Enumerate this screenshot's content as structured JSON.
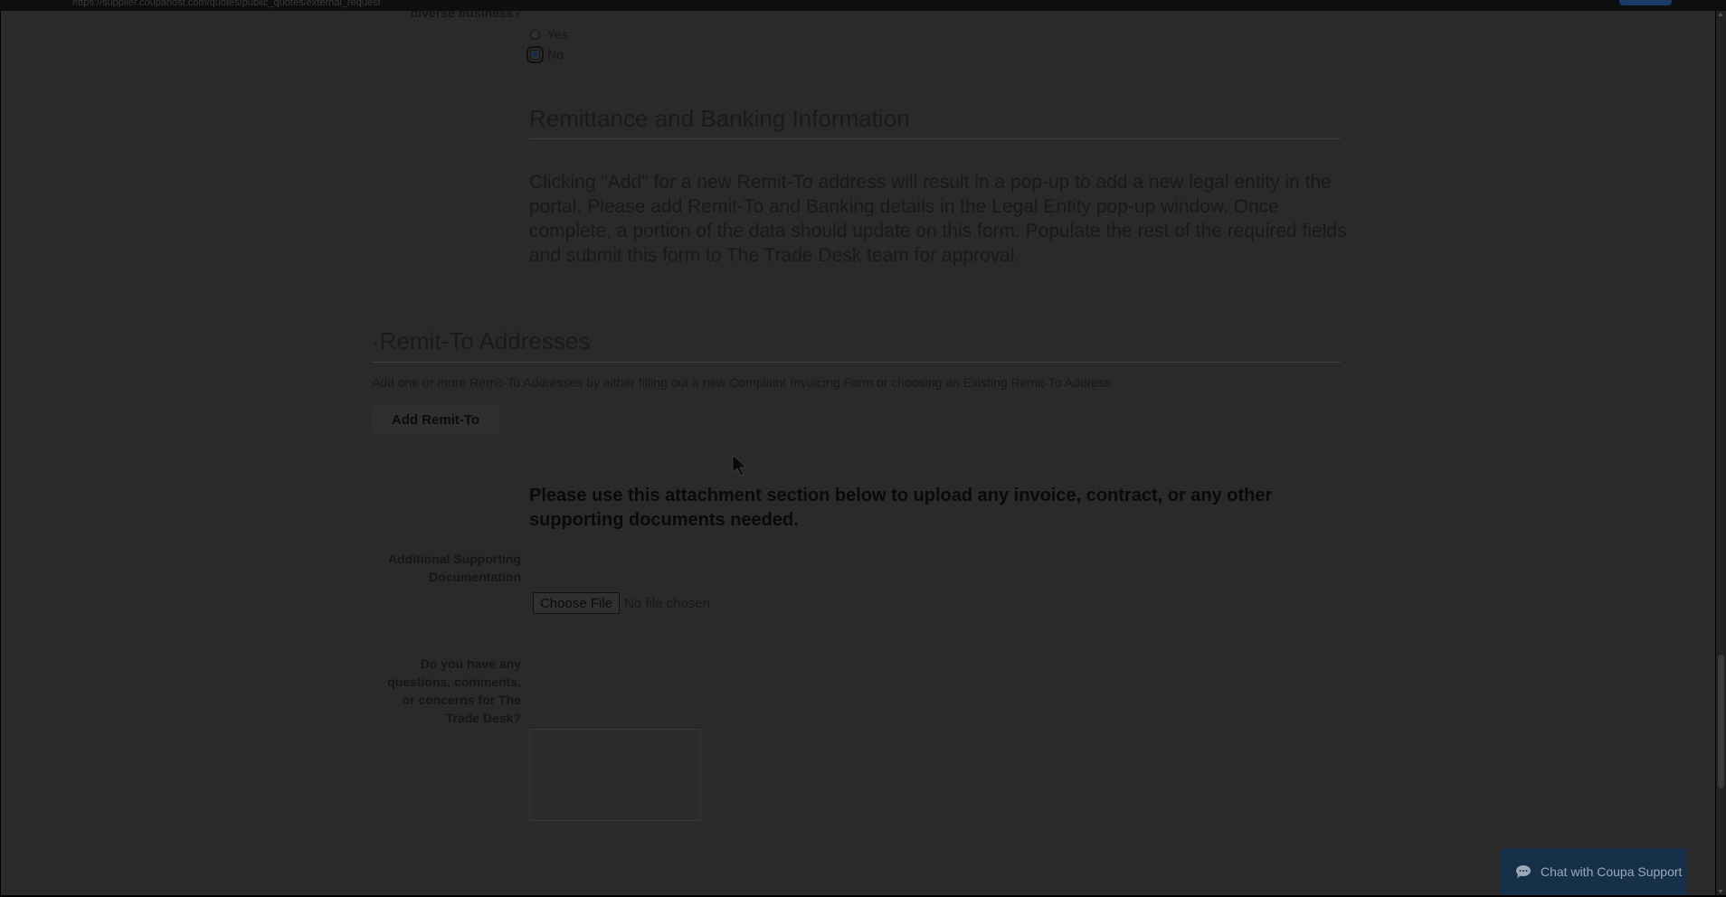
{
  "browser": {
    "url": "https://supplier.coupahost.com/quotes/public_quotes/external_request"
  },
  "diverse": {
    "label_partial": "diverse business?",
    "options": [
      "Yes",
      "No"
    ],
    "selected": "No"
  },
  "remittance": {
    "heading": "Remittance and Banking Information",
    "body": "Clicking \"Add\" for a new Remit-To address will result in a pop-up to add a new legal entity in the portal. Please add Remit-To and Banking details in the Legal Entity pop-up window. Once complete, a portion of the data should update on this form. Populate the rest of the required fields and submit this form to The Trade Desk team for approval."
  },
  "remit_to": {
    "heading": "Remit-To Addresses",
    "required_marker": "·",
    "description": "Add one or more Remit-To Addresses by either filling out a new Compliant Invoicing Form or choosing an Existing Remit-To Address.",
    "add_button": "Add Remit-To"
  },
  "attachments": {
    "instruction": "Please use this attachment section below to upload any invoice, contract, or any other supporting documents needed.",
    "label": "Additional Supporting Documentation",
    "choose_button": "Choose File",
    "status": "No file chosen"
  },
  "questions": {
    "label": "Do you have any questions, comments, or concerns for The Trade Desk?",
    "value": ""
  },
  "chat": {
    "label": "Chat with Coupa Support"
  },
  "colors": {
    "overlay": "#2a2a2a",
    "chat_bg": "#163049"
  }
}
